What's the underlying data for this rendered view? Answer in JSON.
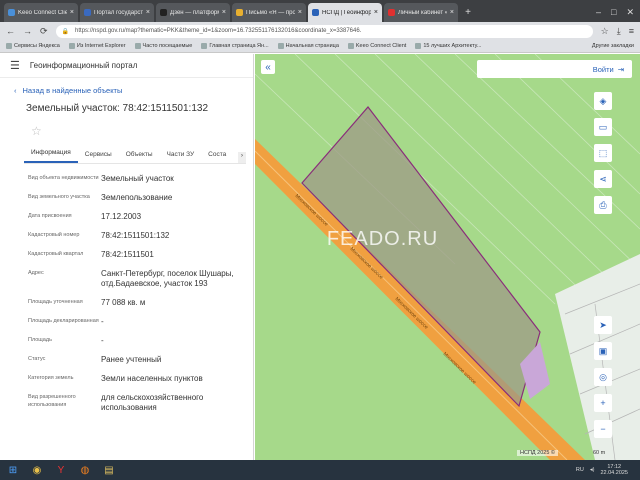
{
  "browser": {
    "tabs": [
      {
        "title": "Keeo Connect Client",
        "color": "#4a90d9",
        "active": false
      },
      {
        "title": "Портал государств",
        "color": "#3a6ac0",
        "active": false
      },
      {
        "title": "Дзен — платформа",
        "color": "#222222",
        "active": false
      },
      {
        "title": "Письмо «Я — про",
        "color": "#e8b030",
        "active": false
      },
      {
        "title": "НСПД | Геоинформ",
        "color": "#2a62b8",
        "active": true
      },
      {
        "title": "Личный кабинет «",
        "color": "#e03030",
        "active": false
      }
    ],
    "new_tab": "+",
    "url": "https://nspd.gov.ru/map?thematic=PKK&theme_id=1&zoom=16.732551176132016&coordinate_x=3387646.",
    "bookmarks": [
      "Сервисы Яндекса",
      "Из Internet Explorer",
      "Часто посещаемые",
      "Главная страница Ян...",
      "Начальная страница",
      "Keeo Connect Client",
      "15 лучших Архитекту..."
    ],
    "other_bookmarks": "Другие закладки"
  },
  "panel": {
    "portal_title": "Геоинформационный портал",
    "back_label": "Назад в найденные объекты",
    "object_title": "Земельный участок: 78:42:1511501:132",
    "tabs": [
      "Информация",
      "Сервисы",
      "Объекты",
      "Части ЗУ",
      "Соста"
    ],
    "rows": [
      {
        "label": "Вид объекта недвижимости",
        "value": "Земельный участок"
      },
      {
        "label": "Вид земельного участка",
        "value": "Землепользование"
      },
      {
        "label": "Дата присвоения",
        "value": "17.12.2003"
      },
      {
        "label": "Кадастровый номер",
        "value": "78:42:1511501:132"
      },
      {
        "label": "Кадастровый квартал",
        "value": "78:42:1511501"
      },
      {
        "label": "Адрес",
        "value": "Санкт-Петербург, поселок Шушары, отд.Бадаевское, участок 193"
      },
      {
        "label": "Площадь уточненная",
        "value": "77 088 кв. м"
      },
      {
        "label": "Площадь декларированная",
        "value": "-"
      },
      {
        "label": "Площадь",
        "value": "-"
      },
      {
        "label": "Статус",
        "value": "Ранее учтенный"
      },
      {
        "label": "Категория земель",
        "value": "Земли населенных пунктов"
      },
      {
        "label": "Вид разрешенного использования",
        "value": "для сельскохозяйственного использования"
      }
    ]
  },
  "map": {
    "login_label": "Войти",
    "road_labels": [
      "Московское шоссе",
      "Московское шоссе",
      "Московское шоссе",
      "Московское шоссе"
    ],
    "watermark": "FEADO.RU",
    "attribution": "НСПД 2025 ©",
    "scale": "60 m"
  },
  "taskbar": {
    "lang": "RU",
    "time": "17:12",
    "date": "22.04.2025"
  },
  "colors": {
    "accent": "#2a62b8",
    "map_green": "#a6d98a",
    "parcel_stroke": "#8a2d7a",
    "road": "#f0a040"
  }
}
